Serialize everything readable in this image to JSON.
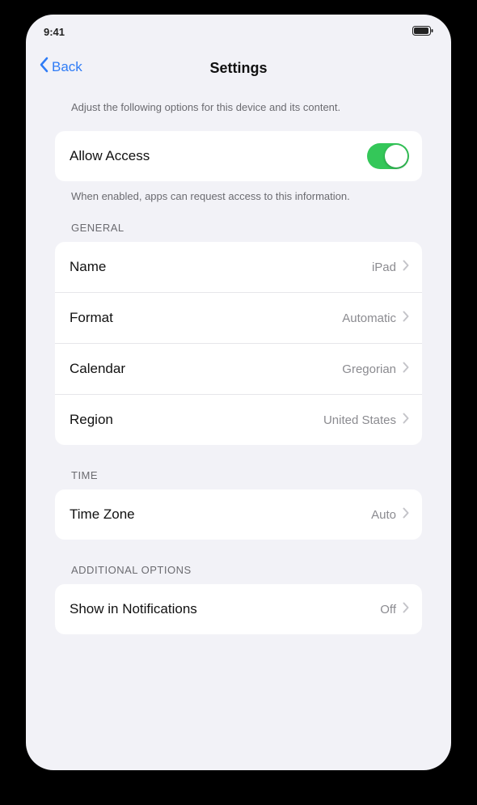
{
  "status_bar": {
    "time": "9:41",
    "signal": "",
    "battery": ""
  },
  "nav": {
    "back_label": "Back",
    "title": "Settings"
  },
  "intro_text": "Adjust the following options for this device and its content.",
  "main_toggle": {
    "label": "Allow Access",
    "on": true
  },
  "main_footnote": "When enabled, apps can request access to this information.",
  "section1": {
    "header": "GENERAL",
    "rows": [
      {
        "label": "Name",
        "value": "iPad"
      },
      {
        "label": "Format",
        "value": "Automatic"
      },
      {
        "label": "Calendar",
        "value": "Gregorian"
      },
      {
        "label": "Region",
        "value": "United States"
      }
    ]
  },
  "section2": {
    "header": "TIME",
    "rows": [
      {
        "label": "Time Zone",
        "value": "Auto"
      }
    ]
  },
  "section3": {
    "header": "ADDITIONAL OPTIONS",
    "rows": [
      {
        "label": "Show in Notifications",
        "value": "Off"
      }
    ]
  },
  "colors": {
    "accent": "#2f7cf6",
    "toggle_on": "#34c759",
    "background": "#f2f2f7"
  }
}
